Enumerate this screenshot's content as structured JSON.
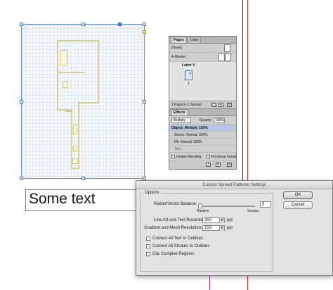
{
  "document": {
    "text_frame_content": "Some text"
  },
  "pages_panel": {
    "tabs": [
      "Pages",
      "Links"
    ],
    "none_label": "[None]",
    "master_label": "A-Master",
    "spread_label": "Letter V",
    "page_number": "1",
    "master_letter": "A",
    "status": "1 Page in 1 Spread"
  },
  "effects_panel": {
    "tab": "Effects",
    "blend_mode": "Multiply",
    "opacity_label": "Opacity:",
    "opacity_value": "100%",
    "rows": [
      "Object: Multiply 100%",
      "Stroke:  Normal 100%",
      "Fill:  Normal 100%",
      "Text:"
    ],
    "isolate_label": "Isolate Blending",
    "knockout_label": "Knockout Group"
  },
  "dialog": {
    "title": "Custom Spread Flattener Settings",
    "options_label": "Options",
    "balance_label": "Raster/Vector Balance:",
    "balance_value": "5",
    "rasters_label": "Rasters",
    "vectors_label": "Vectors",
    "line_art_label": "Line Art and Text Resolution:",
    "line_art_value": "300",
    "gradient_label": "Gradient and Mesh Resolution:",
    "gradient_value": "150",
    "unit": "ppi",
    "checkboxes": [
      "Convert All Text to Outlines",
      "Convert All Strokes to Outlines",
      "Clip Complex Regions"
    ],
    "ok_label": "OK",
    "cancel_label": "Cancel"
  }
}
